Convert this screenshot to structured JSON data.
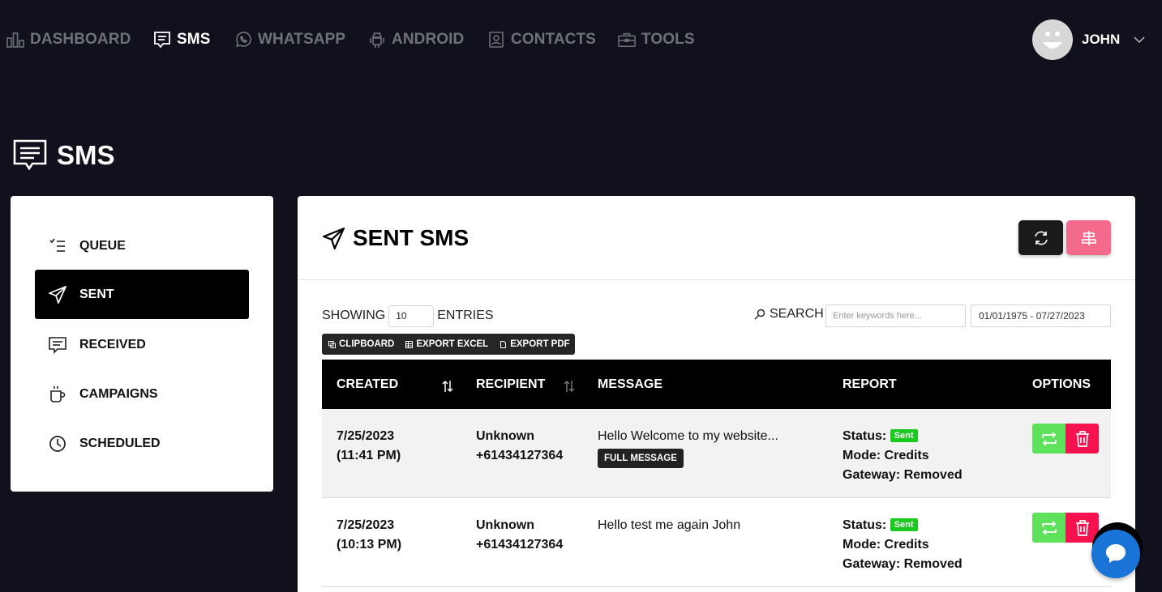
{
  "nav": {
    "items": [
      {
        "label": "DASHBOARD",
        "icon": "bar-chart-icon",
        "active": false
      },
      {
        "label": "SMS",
        "icon": "message-icon",
        "active": true
      },
      {
        "label": "WHATSAPP",
        "icon": "whatsapp-icon",
        "active": false
      },
      {
        "label": "ANDROID",
        "icon": "android-icon",
        "active": false
      },
      {
        "label": "CONTACTS",
        "icon": "contacts-icon",
        "active": false
      },
      {
        "label": "TOOLS",
        "icon": "toolbox-icon",
        "active": false
      }
    ],
    "user": {
      "name": "JOHN",
      "avatar_icon": "smiley-avatar-icon"
    }
  },
  "page": {
    "title": "SMS",
    "icon": "message-icon"
  },
  "sidebar": {
    "items": [
      {
        "label": "QUEUE",
        "icon": "checklist-icon",
        "active": false
      },
      {
        "label": "SENT",
        "icon": "paper-plane-icon",
        "active": true
      },
      {
        "label": "RECEIVED",
        "icon": "message-icon",
        "active": false
      },
      {
        "label": "CAMPAIGNS",
        "icon": "cup-icon",
        "active": false
      },
      {
        "label": "SCHEDULED",
        "icon": "clock-icon",
        "active": false
      }
    ]
  },
  "card": {
    "title": "SENT SMS",
    "title_icon": "paper-plane-icon",
    "showing_label": "SHOWING",
    "entries_value": "10",
    "entries_label": "ENTRIES",
    "search_label": "SEARCH",
    "search_placeholder": "Enter keywords here...",
    "date_range": "01/01/1975 - 07/27/2023",
    "export": {
      "clipboard": "CLIPBOARD",
      "excel": "EXPORT EXCEL",
      "pdf": "EXPORT PDF"
    },
    "header_buttons": {
      "refresh_icon": "refresh-icon",
      "tools_icon": "align-icon"
    }
  },
  "table": {
    "columns": [
      "CREATED",
      "RECIPIENT",
      "MESSAGE",
      "REPORT",
      "OPTIONS"
    ],
    "rows": [
      {
        "date": "7/25/2023",
        "time": "(11:41 PM)",
        "recipient_name": "Unknown",
        "recipient_number": "+61434127364",
        "message": "Hello Welcome to my website...",
        "full_message_label": "FULL MESSAGE",
        "status_label": "Status:",
        "status": "Sent",
        "mode": "Mode: Credits",
        "gateway": "Gateway: Removed"
      },
      {
        "date": "7/25/2023",
        "time": "(10:13 PM)",
        "recipient_name": "Unknown",
        "recipient_number": "+61434127364",
        "message": "Hello test me again John",
        "full_message_label": "",
        "status_label": "Status:",
        "status": "Sent",
        "mode": "Mode: Credits",
        "gateway": "Gateway: Removed"
      }
    ]
  },
  "colors": {
    "background": "#10111c",
    "active_nav": "#ffffff",
    "inactive_nav": "#6f717a",
    "resend": "#5fe25b",
    "delete": "#f6124f",
    "tools_button": "#f46a8c",
    "sent_badge": "#19c91e",
    "chat": "#1a73d6"
  }
}
